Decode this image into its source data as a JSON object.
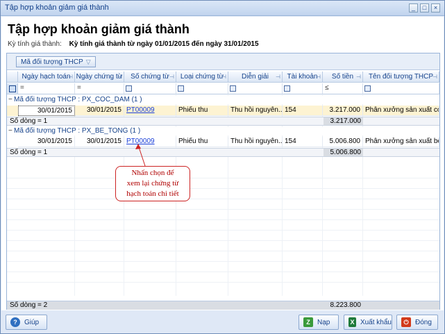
{
  "window": {
    "title": "Tập hợp khoản giảm giá thành",
    "controls": [
      "minimize-icon",
      "maximize-icon",
      "close-icon"
    ]
  },
  "page": {
    "heading": "Tập hợp khoản giảm giá thành",
    "period_label": "Kỳ tính giá thành:",
    "period_value": "Kỳ tính giá thành từ ngày 01/01/2015 đến ngày 31/01/2015"
  },
  "grid": {
    "group_by_chip": "Mã đối tượng THCP",
    "columns": [
      "Ngày hạch toán",
      "Ngày chứng từ",
      "Số chứng từ",
      "Loại chứng từ",
      "Diễn giải",
      "Tài khoản",
      "Số tiền",
      "Tên đối tượng THCP"
    ],
    "filter_symbols": [
      "=",
      "=",
      "",
      "",
      "",
      "",
      "≤",
      ""
    ],
    "groups": [
      {
        "header": "Mã đối tượng THCP : PX_COC_DAM (1 )",
        "toggle": "−",
        "rows": [
          {
            "ngay_hach_toan": "30/01/2015",
            "ngay_chung_tu": "30/01/2015",
            "so_chung_tu": "PT00009",
            "loai_chung_tu": "Phiếu thu",
            "dien_giai": "Thu hồi nguyên...",
            "tai_khoan": "154",
            "so_tien": "3.217.000",
            "ten_doi_tuong": "Phân xưởng sản xuất cọc..."
          }
        ],
        "count_label": "Số dòng = 1",
        "sum": "3.217.000"
      },
      {
        "header": "Mã đối tượng THCP : PX_BE_TONG (1 )",
        "toggle": "−",
        "rows": [
          {
            "ngay_hach_toan": "30/01/2015",
            "ngay_chung_tu": "30/01/2015",
            "so_chung_tu": "PT00009",
            "loai_chung_tu": "Phiếu thu",
            "dien_giai": "Thu hồi nguyên...",
            "tai_khoan": "154",
            "so_tien": "5.006.800",
            "ten_doi_tuong": "Phân xưởng sản xuất bê t..."
          }
        ],
        "count_label": "Số dòng = 1",
        "sum": "5.006.800"
      }
    ],
    "footer": {
      "count_label": "Số dòng = 2",
      "total": "8.223.800"
    }
  },
  "callout": {
    "line1": "Nhấn chọn để",
    "line2": "xem lại chứng từ",
    "line3": "hạch toán chi tiết"
  },
  "buttons": {
    "help": "Giúp",
    "load": "Nạp",
    "export": "Xuất khẩu",
    "close": "Đóng"
  },
  "colors": {
    "accent": "#15428b",
    "link": "#1a3fd8",
    "callout": "#cc2222",
    "selected_row": "#fdf3d2"
  }
}
